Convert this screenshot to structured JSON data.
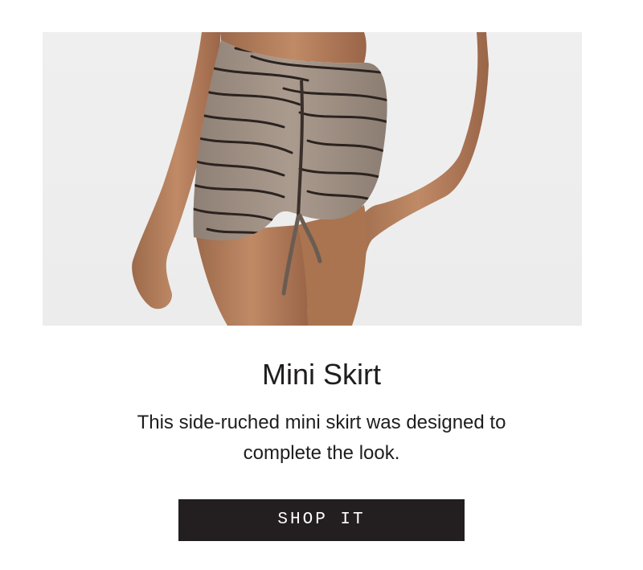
{
  "product": {
    "image_alt": "Model wearing a zebra-print side-ruched mini skirt",
    "title": "Mini Skirt",
    "description_lines": [
      "This side-ruched mini skirt was designed to",
      "complete the look."
    ],
    "cta_label": "SHOP IT"
  },
  "colors": {
    "background": "#ffffff",
    "image_background": "#eeeeee",
    "text": "#1f1d1e",
    "button_background": "#231f20",
    "button_text": "#ffffff",
    "skirt_base": "#a39387",
    "skirt_stripe": "#2b2320",
    "skin": "#b27c5a"
  }
}
